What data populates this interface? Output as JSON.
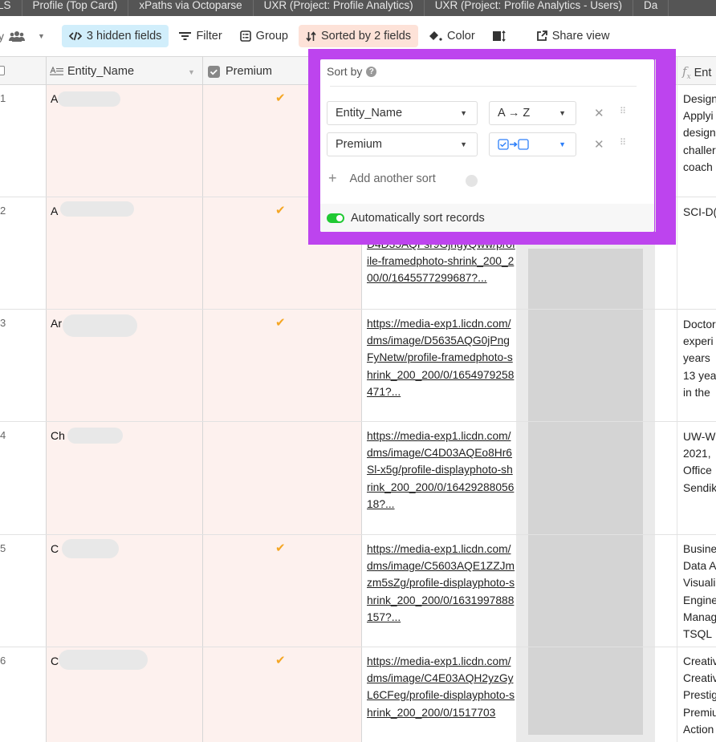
{
  "tabs": [
    "LS",
    "Profile (Top Card)",
    "xPaths via Octoparse",
    "UXR (Project: Profile Analytics)",
    "UXR (Project: Profile Analytics - Users)",
    "Da"
  ],
  "toolbar": {
    "collaborators_icon": "people-icon",
    "hidden_fields": "3 hidden fields",
    "filter": "Filter",
    "group": "Group",
    "sorted": "Sorted by 2 fields",
    "color": "Color",
    "share_view": "Share view"
  },
  "columns": {
    "entity_name": "Entity_Name",
    "premium": "Premium",
    "formula_partial": "Ent"
  },
  "sort_popover": {
    "title": "Sort by",
    "rules": [
      {
        "field": "Entity_Name",
        "direction": "A → Z"
      },
      {
        "field": "Premium",
        "direction": "checked → unchecked"
      }
    ],
    "add_sort": "Add another sort",
    "auto_sort_label": "Automatically sort records",
    "auto_sort_enabled": true
  },
  "rows": [
    {
      "num": "1",
      "name_visible": "A",
      "premium": true,
      "url": "",
      "desc": [
        "Design",
        "Applyi",
        "design",
        "challer",
        "coach"
      ]
    },
    {
      "num": "2",
      "name_visible": "A",
      "premium": true,
      "url": "D4D35AQFsr9GjngyQww/profile-framedphoto-shrink_200_200/0/1645577299687?...",
      "desc": [
        "SCI-D("
      ]
    },
    {
      "num": "3",
      "name_visible": "Ar",
      "premium": true,
      "url": "https://media-exp1.licdn.com/dms/image/D5635AQG0jPngFyNetw/profile-framedphoto-shrink_200_200/0/1654979258471?...",
      "desc": [
        "Doctor",
        "experi",
        "years",
        "13 yea",
        "in the"
      ]
    },
    {
      "num": "4",
      "name_visible": "Ch",
      "premium": false,
      "url": "https://media-exp1.licdn.com/dms/image/C4D03AQEo8Hr6Sl-x5g/profile-displayphoto-shrink_200_200/0/1642928805618?...",
      "desc": [
        "UW-W",
        "2021,",
        "Office",
        "Sendik"
      ]
    },
    {
      "num": "5",
      "name_visible": "C",
      "premium": true,
      "url": "https://media-exp1.licdn.com/dms/image/C5603AQE1ZZJmzm5sZg/profile-displayphoto-shrink_200_200/0/1631997888157?...",
      "desc": [
        "Busine",
        "Data A",
        "Visuali",
        "Engine",
        "Manag",
        "TSQL"
      ]
    },
    {
      "num": "6",
      "name_visible": "C",
      "premium": true,
      "url": "https://media-exp1.licdn.com/dms/image/C4E03AQH2yzGyL6CFeg/profile-displayphoto-shrink_200_200/0/1517703",
      "desc": [
        "Creativ",
        "Creativ",
        "Prestig",
        "Premiu",
        "Action"
      ]
    }
  ],
  "colors": {
    "highlight": "#bd44ee",
    "hidden_fields_bg": "#d1eefb",
    "sorted_bg": "#fde2d8",
    "sorted_column_bg": "#fdf1ee",
    "check": "#f5a623",
    "toggle_on": "#20c933"
  }
}
